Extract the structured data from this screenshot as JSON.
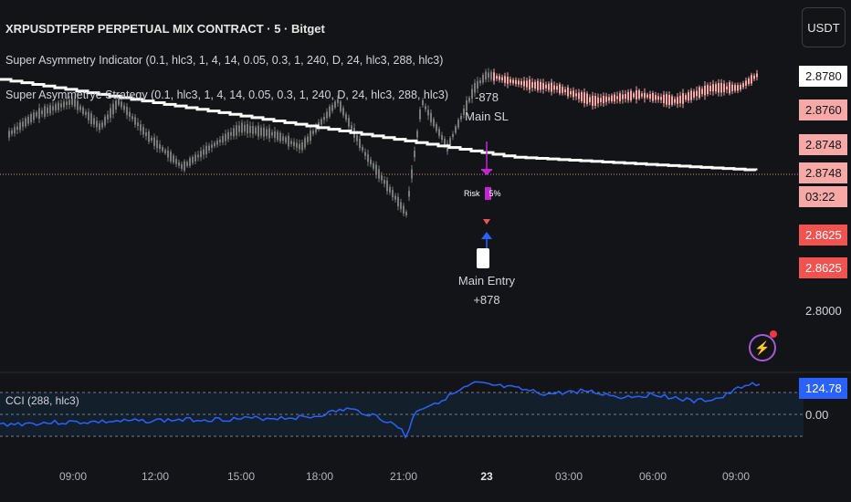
{
  "header": {
    "title": "XRPUSDTPERP PERPETUAL MIX CONTRACT · 5 · Bitget",
    "indicator1": "Super Asymmetry Indicator (0.1, hlc3, 1, 4, 14, 0.05, 0.3, 1, 240, D, 24, hlc3, 288, hlc3)",
    "indicator2": "Super Asymmetrye Strategy (0.1, hlc3, 1, 4, 14, 0.05, 0.3, 1, 240, D, 24, hlc3, 288, hlc3)"
  },
  "currency_button": "USDT",
  "price_labels": [
    {
      "text": "2.8780",
      "bg": "#ffffff",
      "fg": "#131417"
    },
    {
      "text": "2.8760",
      "bg": "#f7a9a8",
      "fg": "#131417"
    },
    {
      "text": "2.8748",
      "bg": "#f7a9a8",
      "fg": "#131417"
    },
    {
      "text": "2.8748",
      "bg": "#f7a9a8",
      "fg": "#131417"
    },
    {
      "text": "03:22",
      "bg": "#f7a9a8",
      "fg": "#131417"
    },
    {
      "text": "2.8625",
      "bg": "#f05350",
      "fg": "#ffffff"
    },
    {
      "text": "2.8625",
      "bg": "#f05350",
      "fg": "#ffffff"
    },
    {
      "text": "2.8000",
      "bg": "transparent",
      "fg": "#d1d4dc"
    }
  ],
  "cci": {
    "label": "CCI (288, hlc3)",
    "value_label": "124.78",
    "zero_label": "0.00",
    "line_color": "#2962ff"
  },
  "trades": {
    "sl_value": "-878",
    "sl_label": "Main SL",
    "entry_label": "Main Entry",
    "entry_value": "+878",
    "risk_text": "Risk",
    "pct_text": "5%"
  },
  "time_axis": [
    "09:00",
    "12:00",
    "15:00",
    "18:00",
    "21:00",
    "23",
    "03:00",
    "06:00",
    "09:00"
  ],
  "colors": {
    "background": "#131417",
    "candle_past": "#7a7a7a",
    "candle_recent": "#f7a9a8",
    "ma_line": "#ffffff",
    "entry_marker": "#2962ff",
    "sl_marker": "#c026d3"
  },
  "chart_data": {
    "type": "line",
    "series": [
      {
        "name": "XRPUSDTPERP",
        "x": [
          "09:00",
          "12:00",
          "15:00",
          "18:00",
          "21:00",
          "23",
          "03:00",
          "06:00",
          "09:00"
        ],
        "values": [
          2.863,
          2.857,
          2.849,
          2.858,
          2.834,
          2.874,
          2.869,
          2.866,
          2.874
        ]
      },
      {
        "name": "CCI (288, hlc3)",
        "x": [
          "09:00",
          "12:00",
          "15:00",
          "18:00",
          "21:00",
          "23",
          "03:00",
          "06:00",
          "09:00"
        ],
        "values": [
          -30,
          -20,
          -15,
          -10,
          -80,
          120,
          100,
          90,
          124.78
        ]
      }
    ],
    "ylim": [
      2.8,
      2.88
    ],
    "grid": false,
    "legend": "top-left"
  }
}
